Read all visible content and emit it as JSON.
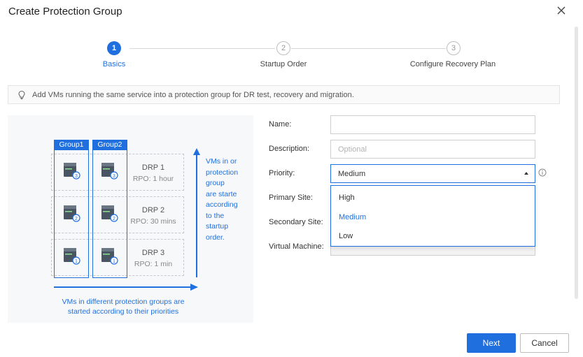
{
  "dialog": {
    "title": "Create Protection Group"
  },
  "stepper": {
    "steps": [
      {
        "number": "1",
        "label": "Basics",
        "state": "active"
      },
      {
        "number": "2",
        "label": "Startup Order",
        "state": "inactive"
      },
      {
        "number": "3",
        "label": "Configure Recovery Plan",
        "state": "inactive"
      }
    ]
  },
  "hint": {
    "icon": "lightbulb-icon",
    "text": "Add VMs running the same service into a protection group for DR test, recovery and migration."
  },
  "illustration": {
    "groups": [
      "Group1",
      "Group2"
    ],
    "rows": [
      {
        "name": "DRP 1",
        "rpo": "RPO: 1 hour",
        "badge": "3"
      },
      {
        "name": "DRP 2",
        "rpo": "RPO: 30 mins",
        "badge": "2"
      },
      {
        "name": "DRP 3",
        "rpo": "RPO: 1 min",
        "badge": "1"
      }
    ],
    "vertical_caption_lines": [
      "VMs in or",
      "protection",
      "group",
      "are starte",
      "according",
      "to the",
      "startup",
      "order."
    ],
    "horizontal_caption_lines": [
      "VMs in different protection groups are",
      "started according to their priorities"
    ]
  },
  "form": {
    "name": {
      "label": "Name:",
      "value": ""
    },
    "description": {
      "label": "Description:",
      "placeholder": "Optional"
    },
    "priority": {
      "label": "Priority:",
      "value": "Medium",
      "options": [
        "High",
        "Medium",
        "Low"
      ]
    },
    "primary_site": {
      "label": "Primary Site:"
    },
    "secondary_site": {
      "label": "Secondary Site:"
    },
    "virtual_machine": {
      "label": "Virtual Machine:"
    }
  },
  "footer": {
    "next_label": "Next",
    "cancel_label": "Cancel"
  },
  "colors": {
    "accent": "#1f6fde"
  }
}
